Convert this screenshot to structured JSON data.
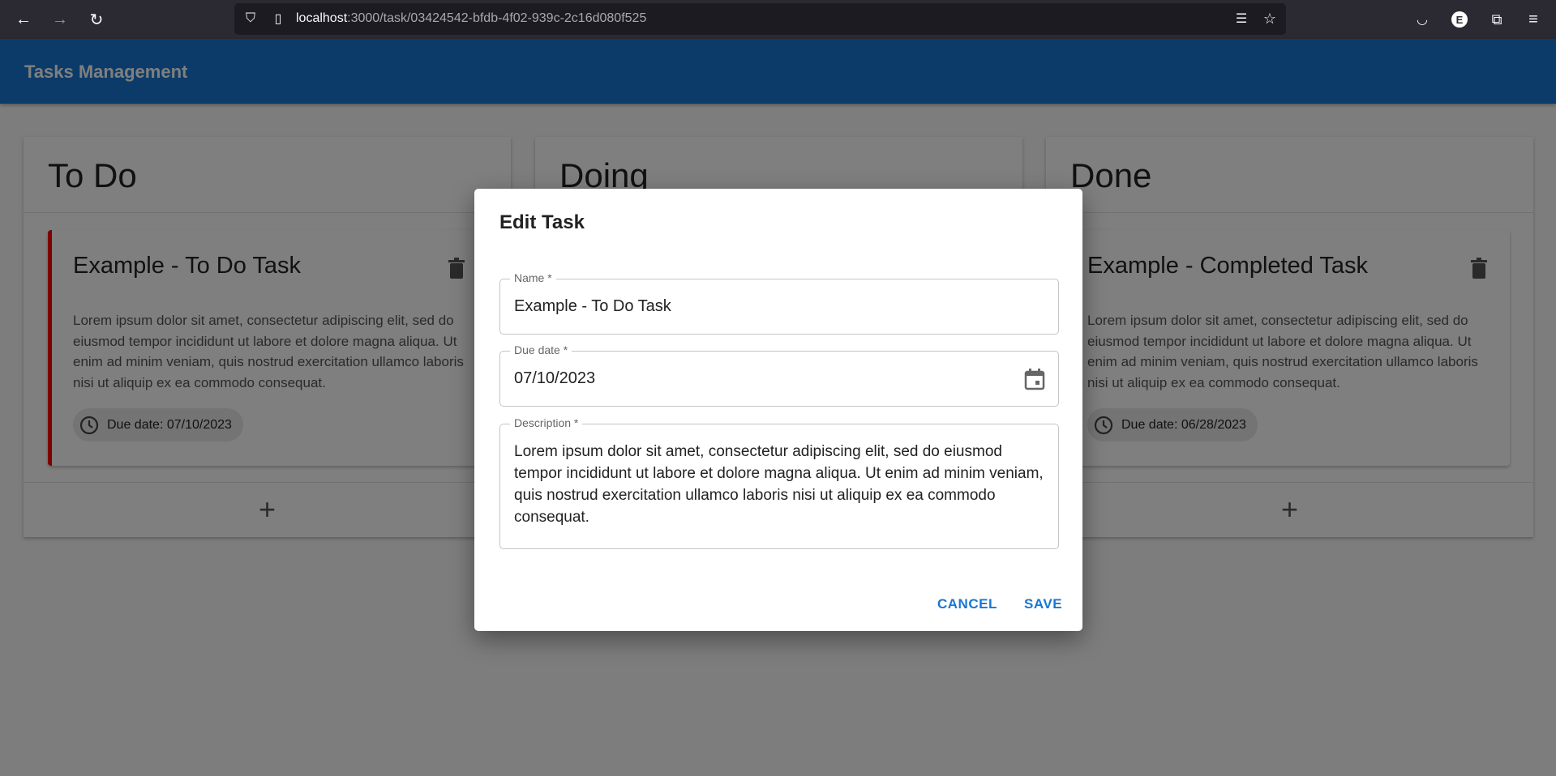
{
  "browser": {
    "url_host": "localhost",
    "url_rest": ":3000/task/03424542-bfdb-4f02-939c-2c16d080f525",
    "profile_initial": "E"
  },
  "app": {
    "title": "Tasks Management",
    "accent": "#1976d2"
  },
  "columns": [
    {
      "title": "To Do",
      "card": {
        "title": "Example - To Do Task",
        "description": "Lorem ipsum dolor sit amet, consectetur adipiscing elit, sed do eiusmod tempor incididunt ut labore et dolore magna aliqua. Ut enim ad minim veniam, quis nostrud exercitation ullamco laboris nisi ut aliquip ex ea commodo consequat.",
        "due": "Due date: 07/10/2023",
        "border_color": "#ff0000"
      }
    },
    {
      "title": "Doing"
    },
    {
      "title": "Done",
      "card": {
        "title": "Example - Completed Task",
        "description": "Lorem ipsum dolor sit amet, consectetur adipiscing elit, sed do eiusmod tempor incididunt ut labore et dolore magna aliqua. Ut enim ad minim veniam, quis nostrud exercitation ullamco laboris nisi ut aliquip ex ea commodo consequat.",
        "due": "Due date: 06/28/2023"
      }
    }
  ],
  "add_label": "+",
  "dialog": {
    "title": "Edit Task",
    "name_label": "Name *",
    "name_value": "Example - To Do Task",
    "due_label": "Due date *",
    "due_value": "07/10/2023",
    "desc_label": "Description *",
    "desc_value": "Lorem ipsum dolor sit amet, consectetur adipiscing elit, sed do eiusmod tempor incididunt ut labore et dolore magna aliqua. Ut enim ad minim veniam, quis nostrud exercitation ullamco laboris nisi ut aliquip ex ea commodo consequat.",
    "cancel": "CANCEL",
    "save": "SAVE"
  }
}
